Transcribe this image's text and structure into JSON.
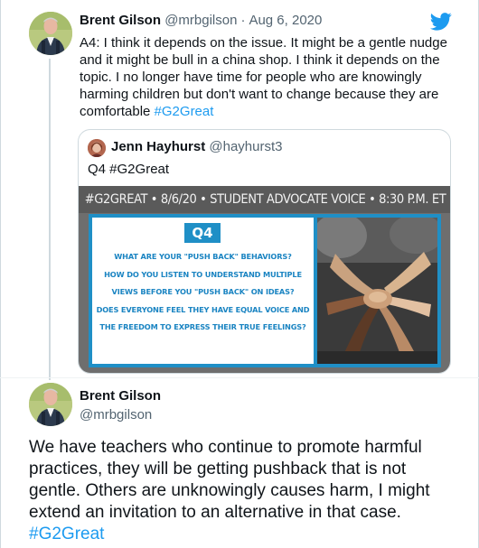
{
  "tweet1": {
    "author_name": "Brent Gilson",
    "author_handle": "@mrbgilson",
    "separator": "·",
    "date": "Aug 6, 2020",
    "text": "A4: I think it depends on the issue. It might be a gentle nudge and it might be bull in a china shop. I think it depends on the topic. I no longer have time for people who are knowingly harming children but don't want to change because they are comfortable ",
    "hashtag": "#G2Great"
  },
  "quoted": {
    "author_name": "Jenn Hayhurst",
    "author_handle": "@hayhurst3",
    "text": "Q4 #G2Great",
    "image": {
      "banner": "#G2GREAT • 8/6/20 • STUDENT ADVOCATE VOICE • 8:30 P.M. ET",
      "badge": "Q4",
      "lines": [
        "WHAT ARE YOUR \"PUSH BACK\" BEHAVIORS?",
        "HOW DO YOU LISTEN TO UNDERSTAND MULTIPLE",
        "VIEWS BEFORE YOU \"PUSH BACK\" ON IDEAS?",
        "DOES EVERYONE FEEL THEY HAVE EQUAL VOICE AND",
        "THE FREEDOM TO EXPRESS THEIR TRUE FEELINGS?"
      ]
    }
  },
  "tweet2": {
    "author_name": "Brent Gilson",
    "author_handle": "@mrbgilson",
    "text": "We have teachers who continue to promote harmful practices, they will be getting pushback that is not gentle. Others are unknowingly causes harm, I might extend an invitation to an alternative in that case. ",
    "hashtag": "#G2Great"
  },
  "icons": {
    "brand": "twitter-bird-icon"
  },
  "colors": {
    "link": "#1d9bf0",
    "secondary_text": "#536471",
    "brand_blue": "#1d9bf0",
    "graphic_blue": "#1f8fc6"
  }
}
